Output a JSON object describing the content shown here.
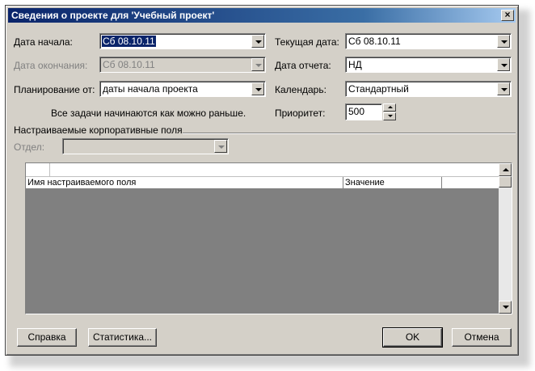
{
  "window": {
    "title": "Сведения о проекте для 'Учебный проект'",
    "close_label": "×"
  },
  "left": {
    "start_date_label": "Дата начала:",
    "start_date_value": "Сб 08.10.11",
    "finish_date_label": "Дата окончания:",
    "finish_date_value": "Сб 08.10.11",
    "schedule_from_label": "Планирование от:",
    "schedule_from_value": "даты начала проекта",
    "schedule_note": "Все задачи начинаются как можно раньше."
  },
  "right": {
    "current_date_label": "Текущая дата:",
    "current_date_value": "Сб 08.10.11",
    "status_date_label": "Дата отчета:",
    "status_date_value": "НД",
    "calendar_label": "Календарь:",
    "calendar_value": "Стандартный",
    "priority_label": "Приоритет:",
    "priority_value": "500"
  },
  "custom_fields": {
    "group_title": "Настраиваемые корпоративные поля",
    "department_label": "Отдел:",
    "department_value": "",
    "col_name": "Имя настраиваемого поля",
    "col_value": "Значение"
  },
  "buttons": {
    "help": "Справка",
    "statistics": "Статистика...",
    "ok": "OK",
    "cancel": "Отмена"
  },
  "colors": {
    "dialog_bg": "#d4d0c8",
    "title_gradient_start": "#0a246a",
    "grid_empty": "#808080"
  }
}
